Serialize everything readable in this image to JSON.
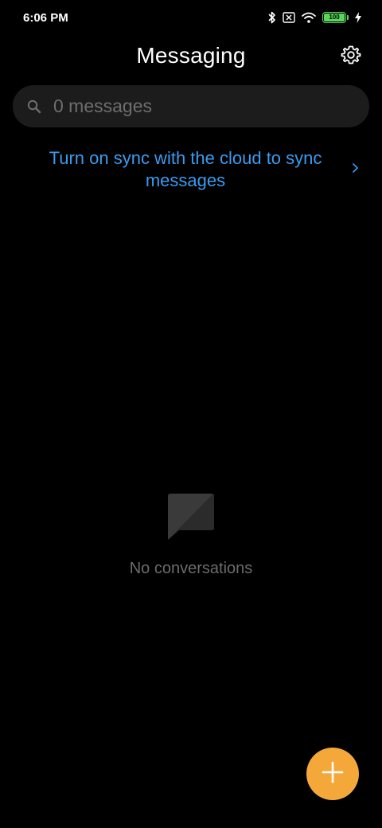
{
  "status_bar": {
    "time": "6:06 PM",
    "battery_level": "100",
    "icons": [
      "bluetooth-icon",
      "no-sim-icon",
      "wifi-icon",
      "battery-icon",
      "charging-icon"
    ]
  },
  "header": {
    "title": "Messaging",
    "settings_icon": "gear-icon"
  },
  "search": {
    "placeholder": "0 messages",
    "value": ""
  },
  "sync_banner": {
    "text": "Turn on sync with the cloud to sync messages"
  },
  "empty_state": {
    "icon": "message-bubble-icon",
    "text": "No conversations"
  },
  "fab": {
    "icon": "plus-icon",
    "color": "#f5a83a"
  },
  "colors": {
    "background": "#000000",
    "accent_link": "#3a9bf0",
    "fab": "#f5a83a",
    "battery": "#59d65c"
  }
}
